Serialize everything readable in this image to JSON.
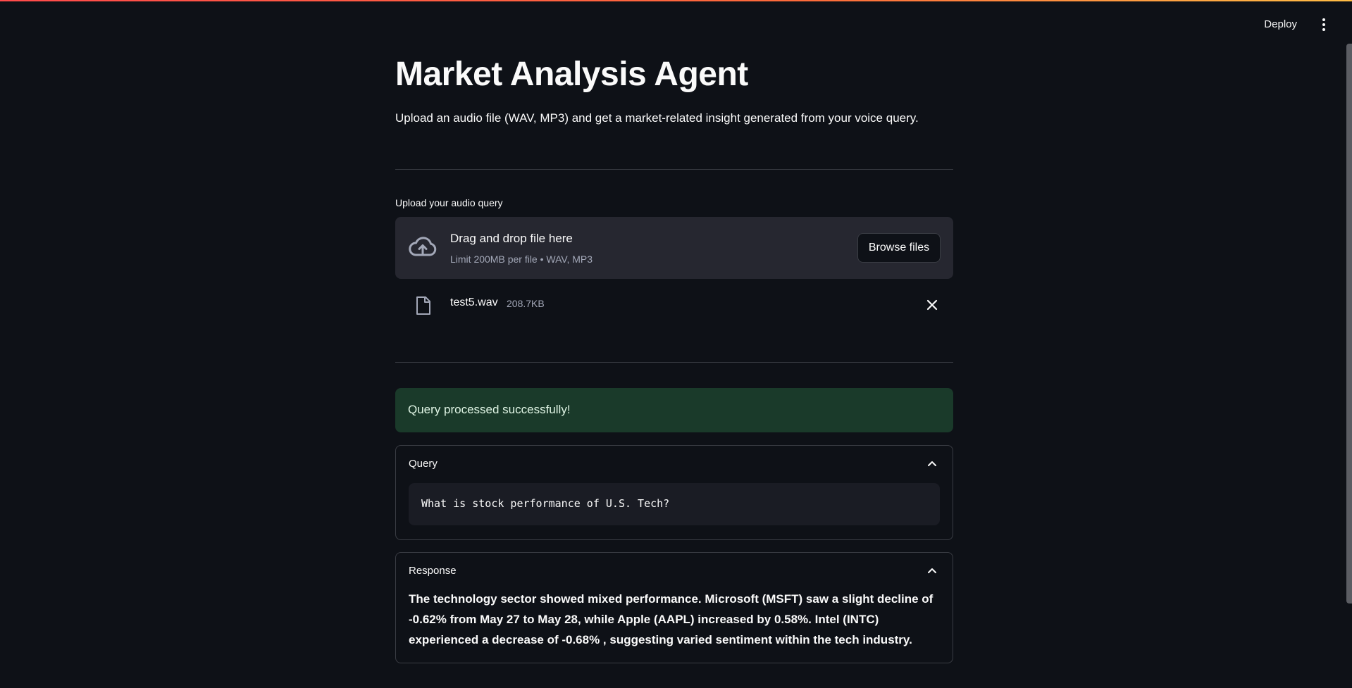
{
  "toolbar": {
    "deploy_label": "Deploy"
  },
  "page": {
    "title": "Market Analysis Agent",
    "subtitle": "Upload an audio file (WAV, MP3) and get a market-related insight generated from your voice query."
  },
  "uploader": {
    "label": "Upload your audio query",
    "drop_title": "Drag and drop file here",
    "limit_text": "Limit 200MB per file • WAV, MP3",
    "browse_label": "Browse files",
    "icon": "cloud-upload-icon"
  },
  "file": {
    "name": "test5.wav",
    "size": "208.7KB",
    "icon": "file-icon"
  },
  "alert": {
    "message": "Query processed successfully!",
    "color": "#1a3a2a"
  },
  "query_section": {
    "title": "Query",
    "text": "What is stock performance of U.S. Tech?"
  },
  "response_section": {
    "title": "Response",
    "text": "The technology sector showed mixed performance. Microsoft (MSFT) saw a slight decline of -0.62% from May 27 to May 28, while Apple (AAPL) increased by 0.58%. Intel (INTC) experienced a decrease of -0.68% , suggesting varied sentiment within the tech industry."
  }
}
